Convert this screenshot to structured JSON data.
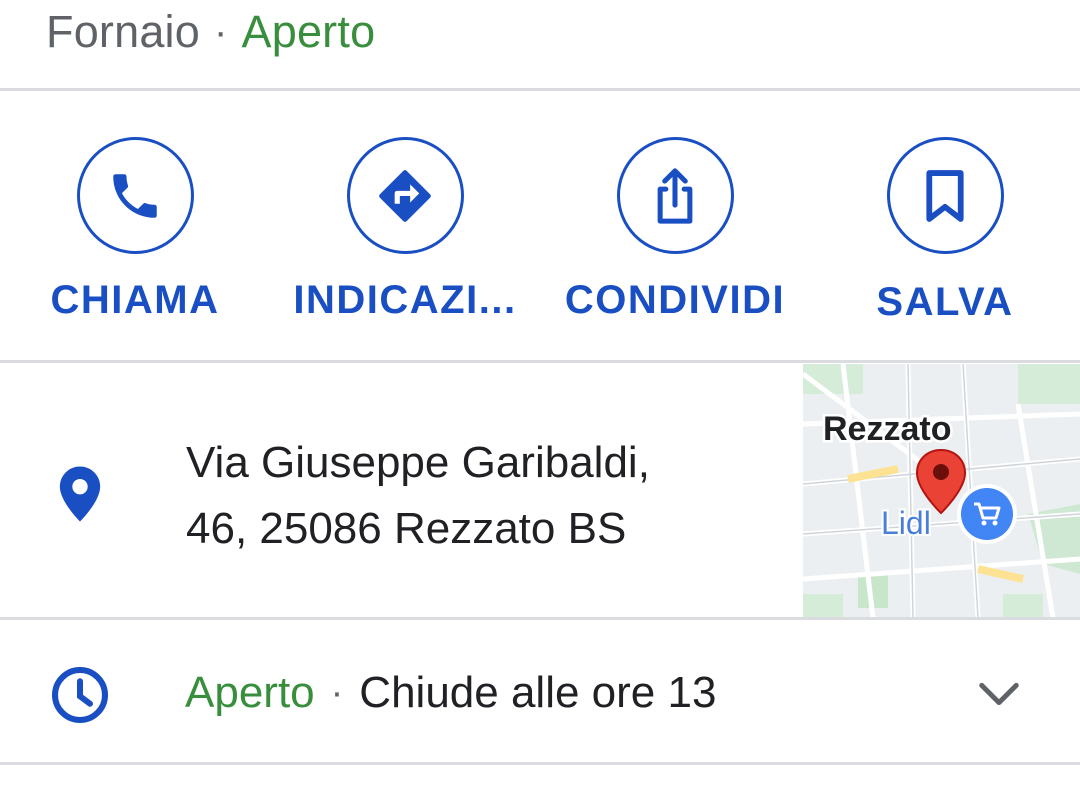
{
  "header": {
    "category": "Fornaio",
    "separator": "·",
    "status": "Aperto"
  },
  "actions": [
    {
      "label": "CHIAMA",
      "icon": "phone-icon"
    },
    {
      "label": "INDICAZI...",
      "icon": "directions-icon"
    },
    {
      "label": "CONDIVIDI",
      "icon": "share-icon"
    },
    {
      "label": "SALVA",
      "icon": "bookmark-icon"
    }
  ],
  "address": {
    "line1": "Via Giuseppe Garibaldi,",
    "line2": "46, 25086 Rezzato BS",
    "icon": "location-pin-icon"
  },
  "map": {
    "place_label": "Rezzato",
    "poi_label": "Lidl"
  },
  "hours": {
    "status": "Aperto",
    "separator": "·",
    "detail": "Chiude alle ore 13",
    "icon": "clock-icon"
  },
  "colors": {
    "accent": "#1a4fc4",
    "open": "#388e3c",
    "pin": "#d93025",
    "divider": "#dadce0"
  }
}
